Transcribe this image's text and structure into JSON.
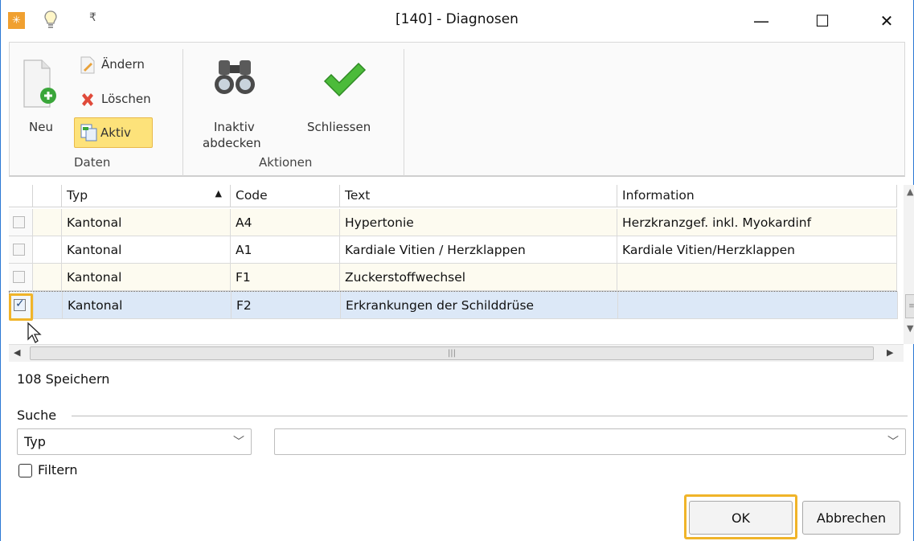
{
  "window": {
    "title": "[140] - Diagnosen",
    "minimize_glyph": "—",
    "maximize_glyph": "☐",
    "close_glyph": "✕"
  },
  "ribbon": {
    "neu_label": "Neu",
    "aendern_label": "Ändern",
    "loeschen_label": "Löschen",
    "aktiv_label": "Aktiv",
    "inaktiv_line1": "Inaktiv",
    "inaktiv_line2": "abdecken",
    "schliessen_label": "Schliessen",
    "group_daten": "Daten",
    "group_aktionen": "Aktionen"
  },
  "grid": {
    "columns": [
      "Typ",
      "Code",
      "Text",
      "Information"
    ],
    "rows": [
      {
        "checked": false,
        "typ": "Kantonal",
        "code": "A4",
        "text": "Hypertonie",
        "information": "Herzkranzgef. inkl. Myokardinf"
      },
      {
        "checked": false,
        "typ": "Kantonal",
        "code": "A1",
        "text": "Kardiale Vitien / Herzklappen",
        "information": "Kardiale Vitien/Herzklappen"
      },
      {
        "checked": false,
        "typ": "Kantonal",
        "code": "F1",
        "text": "Zuckerstoffwechsel",
        "information": ""
      },
      {
        "checked": true,
        "typ": "Kantonal",
        "code": "F2",
        "text": "Erkrankungen der Schilddrüse",
        "information": ""
      }
    ]
  },
  "status": {
    "count_text": "108 Speichern"
  },
  "search": {
    "label": "Suche",
    "field_select_value": "Typ",
    "value_select_value": "",
    "filter_label": "Filtern"
  },
  "footer": {
    "ok_label": "OK",
    "cancel_label": "Abbrechen"
  },
  "colors": {
    "accent_highlight": "#f0b429",
    "selected_row": "#dce8f7",
    "row_bg": "#fdfbf0",
    "aktiv_bg": "#fde27a"
  }
}
